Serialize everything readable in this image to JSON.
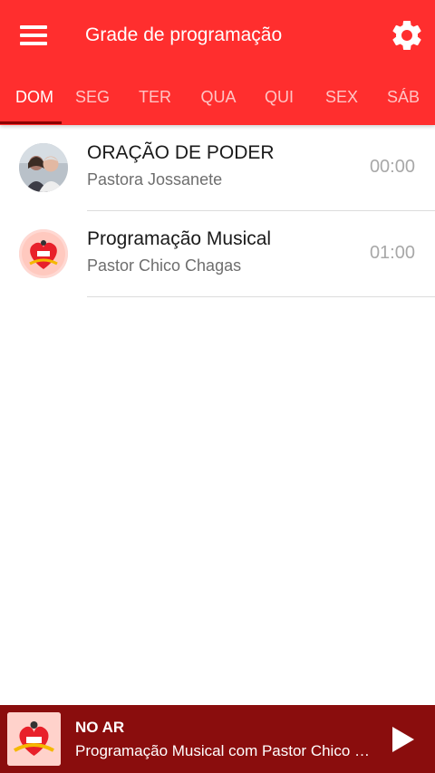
{
  "header": {
    "title": "Grade de programação",
    "menu_icon": "hamburger-menu-icon",
    "settings_icon": "gear-icon",
    "background_color": "#ff2e2e"
  },
  "tabs": [
    {
      "label": "DOM",
      "active": true
    },
    {
      "label": "SEG",
      "active": false
    },
    {
      "label": "TER",
      "active": false
    },
    {
      "label": "QUA",
      "active": false
    },
    {
      "label": "QUI",
      "active": false
    },
    {
      "label": "SEX",
      "active": false
    },
    {
      "label": "SÁB",
      "active": false
    }
  ],
  "schedule": [
    {
      "name": "ORAÇÃO DE PODER",
      "host": "Pastora Jossanete",
      "time": "00:00",
      "avatar": "couple-photo-avatar"
    },
    {
      "name": "Programação Musical",
      "host": "Pastor Chico Chagas",
      "time": "01:00",
      "avatar": "radio-heart-logo-avatar"
    }
  ],
  "player": {
    "label": "NO AR",
    "now_playing": "Programação Musical com Pastor Chico Chagas",
    "play_icon": "play-icon",
    "background_color": "#8a0d0d"
  }
}
